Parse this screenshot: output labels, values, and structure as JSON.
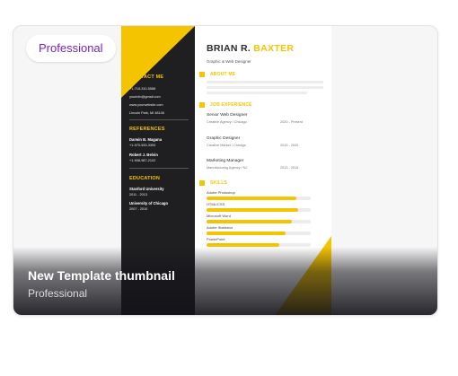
{
  "card": {
    "badge": "Professional",
    "title": "New Template thumbnail",
    "subtitle": "Professional"
  },
  "resume": {
    "name_first": "BRIAN R.",
    "name_last": "BAXTER",
    "role": "Graphic & Web Designer",
    "accent_color": "#f5c400",
    "sidebar": {
      "contact_heading": "CONTACT ME",
      "contact_lines": [
        "+1-718-310-5588",
        "yourinfo@gmail.com",
        "www.yourwebsite.com",
        "Lincoln Park, MI 48146"
      ],
      "references_heading": "REFERENCES",
      "references": [
        {
          "name": "Darwin B. Magana",
          "phone": "+1-970-533-3393"
        },
        {
          "name": "Robert J. Belvin",
          "phone": "+1-908-987-2102"
        }
      ],
      "education_heading": "EDUCATION",
      "education": [
        {
          "school": "Stanford University",
          "years": "2011 - 2013"
        },
        {
          "school": "University of Chicago",
          "years": "2007 - 2010"
        }
      ]
    },
    "sections": {
      "about": "ABOUT ME",
      "experience": "JOB EXPERIENCE",
      "skills": "SKILLS"
    },
    "jobs": [
      {
        "title": "Senior Web Designer",
        "company": "Creative Agency / Chicago",
        "dates": "2020 - Present"
      },
      {
        "title": "Graphic Designer",
        "company": "Creative Market / Chicago",
        "dates": "2015 - 2020"
      },
      {
        "title": "Marketing Manager",
        "company": "Manufacturing Agency / NJ",
        "dates": "2013 - 2015"
      }
    ],
    "skills": [
      {
        "name": "Adobe Photoshop",
        "level": 0.86
      },
      {
        "name": "HTML/CSS",
        "level": 0.88
      },
      {
        "name": "Microsoft Word",
        "level": 0.82
      },
      {
        "name": "Adobe Illustrator",
        "level": 0.76
      },
      {
        "name": "PowerPoint",
        "level": 0.7
      }
    ]
  }
}
